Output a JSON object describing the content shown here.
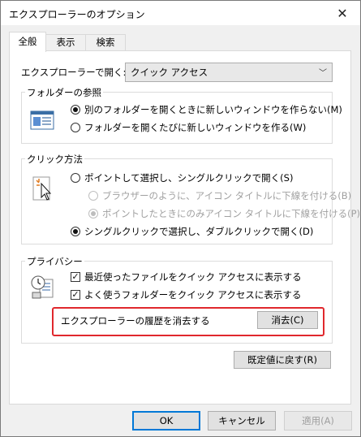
{
  "window": {
    "title": "エクスプローラーのオプション",
    "close_glyph": "✕"
  },
  "tabs": [
    {
      "label": "全般",
      "active": true
    },
    {
      "label": "表示",
      "active": false
    },
    {
      "label": "検索",
      "active": false
    }
  ],
  "open_with": {
    "label": "エクスプローラーで開く:",
    "value": "クイック アクセス",
    "arrow": "﹀"
  },
  "browse_folders": {
    "title": "フォルダーの参照",
    "icon": "folder-window-icon",
    "options": [
      {
        "label": "別のフォルダーを開くときに新しいウィンドウを作らない(M)",
        "selected": true
      },
      {
        "label": "フォルダーを開くたびに新しいウィンドウを作る(W)",
        "selected": false
      }
    ]
  },
  "click_items": {
    "title": "クリック方法",
    "icon": "pointer-click-icon",
    "options": [
      {
        "label": "ポイントして選択し、シングルクリックで開く(S)",
        "selected": false,
        "enabled": true
      },
      {
        "label": "ブラウザーのように、アイコン タイトルに下線を付ける(B)",
        "selected": false,
        "enabled": false
      },
      {
        "label": "ポイントしたときにのみアイコン タイトルに下線を付ける(P)",
        "selected": true,
        "enabled": false
      },
      {
        "label": "シングルクリックで選択し、ダブルクリックで開く(D)",
        "selected": true,
        "enabled": true
      }
    ]
  },
  "privacy": {
    "title": "プライバシー",
    "icon": "privacy-clock-document-icon",
    "checks": [
      {
        "label": "最近使ったファイルをクイック アクセスに表示する",
        "checked": true
      },
      {
        "label": "よく使うフォルダーをクイック アクセスに表示する",
        "checked": true
      }
    ],
    "clear_label": "エクスプローラーの履歴を消去する",
    "clear_button": "消去(C)"
  },
  "restore_defaults": "既定値に戻す(R)",
  "footer": {
    "ok": "OK",
    "cancel": "キャンセル",
    "apply": "適用(A)"
  },
  "colors": {
    "highlight_border": "#e0282d",
    "default_button_border": "#0078d7"
  }
}
